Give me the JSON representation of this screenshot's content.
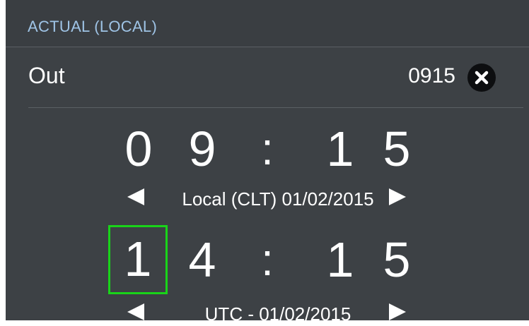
{
  "header": {
    "title": "ACTUAL (LOCAL)"
  },
  "out_row": {
    "label": "Out",
    "value": "0915"
  },
  "local_time": {
    "digits": [
      "0",
      "9",
      "1",
      "5"
    ],
    "separator": ":",
    "label": "Local (CLT) 01/02/2015"
  },
  "utc_time": {
    "digits": [
      "1",
      "4",
      "1",
      "5"
    ],
    "separator": ":",
    "label": "UTC - 01/02/2015",
    "selected_digit_index": 0
  },
  "colors": {
    "background": "#3d4145",
    "header_text": "#9fc4e6",
    "selection": "#19d419",
    "text": "#ffffff"
  },
  "icons": {
    "clear": "close-circle-icon",
    "previous": "left-triangle-icon",
    "next": "right-triangle-icon"
  }
}
